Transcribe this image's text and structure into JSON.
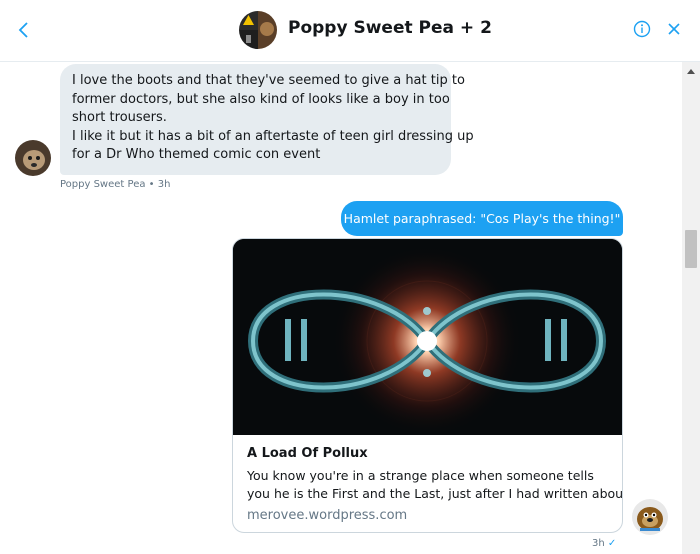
{
  "header": {
    "title": "Poppy Sweet Pea + 2"
  },
  "incoming": {
    "lines": [
      "I love the boots and that they've seemed to give a hat tip to",
      "former doctors, but she also kind of looks like a boy in too",
      "short trousers.",
      "I like it but it has a bit of an aftertaste of teen girl dressing up",
      "for a Dr Who themed comic con event"
    ],
    "meta": "Poppy Sweet Pea • 3h"
  },
  "outgoing": {
    "text": "Hamlet paraphrased: \"Cos Play's the thing!\"",
    "card": {
      "title": "A Load Of Pollux",
      "desc_lines": [
        "  You know you're in a strange place when someone tells",
        "you he is the First and the Last, just after I had written about"
      ],
      "url": "merovee.wordpress.com"
    },
    "time": "3h",
    "status": "✓"
  },
  "colors": {
    "accent": "#1da1f2",
    "bubble_gray": "#e6ecf0",
    "meta_gray": "#657786"
  },
  "icons": {
    "back": "chevron-left-icon",
    "info": "info-icon",
    "close": "close-icon"
  }
}
